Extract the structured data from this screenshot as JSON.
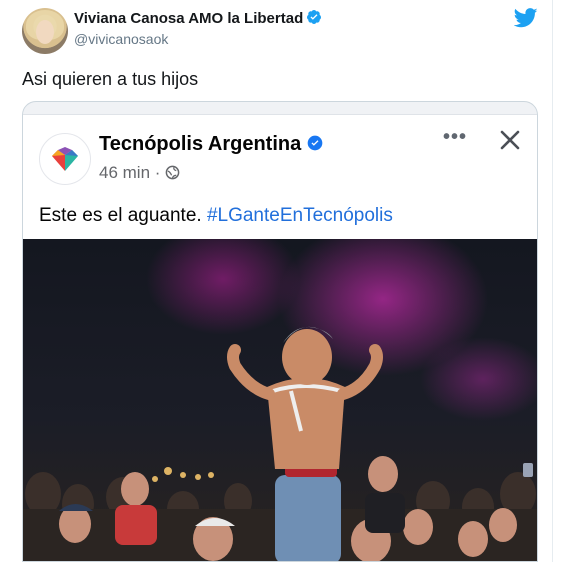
{
  "tweet": {
    "display_name": "Viviana Canosa AMO la Libertad",
    "handle": "@vivicanosaok",
    "text": "Asi quieren a tus hijos",
    "brand_color": "#1DA1F2"
  },
  "quoted_post": {
    "page_name": "Tecnópolis Argentina",
    "time": "46 min · ",
    "text": "Este es el aguante. ",
    "hashtag": "#LGanteEnTecnópolis",
    "icons": [
      "more-dots-icon",
      "close-icon",
      "globe-icon",
      "verified-icon"
    ],
    "hashtag_color": "#216FDB"
  }
}
